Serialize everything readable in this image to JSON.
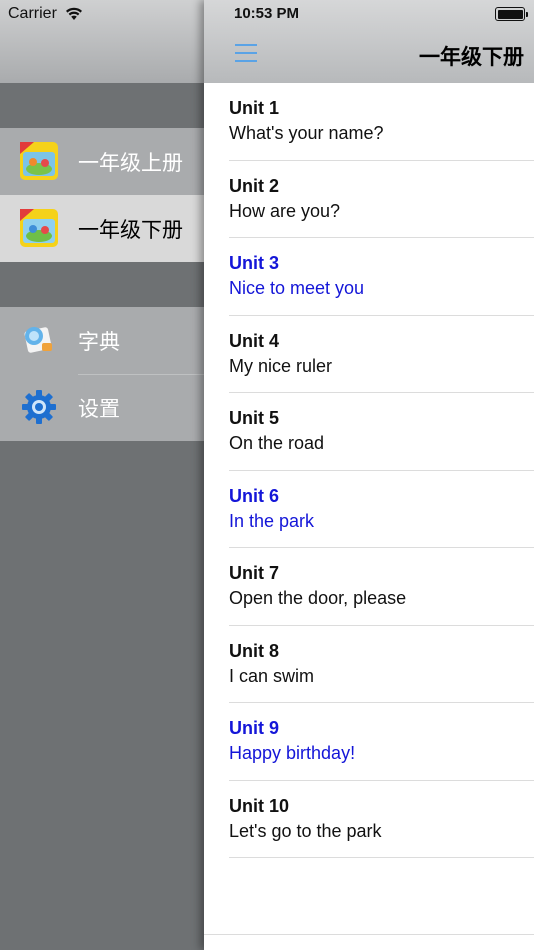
{
  "status": {
    "carrier": "Carrier",
    "time": "10:53 PM"
  },
  "drawer": {
    "books": [
      {
        "label": "一年级上册",
        "selected": false
      },
      {
        "label": "一年级下册",
        "selected": true
      }
    ],
    "tools": [
      {
        "label": "字典",
        "icon": "dictionary-icon"
      },
      {
        "label": "设置",
        "icon": "gear-icon"
      }
    ]
  },
  "header": {
    "title": "一年级下册",
    "menu_icon": "hamburger-menu-icon"
  },
  "units": [
    {
      "unit": "Unit 1",
      "title": "What's your name?",
      "highlight": false
    },
    {
      "unit": "Unit 2",
      "title": "How are you?",
      "highlight": false
    },
    {
      "unit": "Unit 3",
      "title": "Nice to meet you",
      "highlight": true
    },
    {
      "unit": "Unit 4",
      "title": "My nice ruler",
      "highlight": false
    },
    {
      "unit": "Unit 5",
      "title": "On the road",
      "highlight": false
    },
    {
      "unit": "Unit 6",
      "title": "In the park",
      "highlight": true
    },
    {
      "unit": "Unit 7",
      "title": "Open the door, please",
      "highlight": false
    },
    {
      "unit": "Unit 8",
      "title": "I can swim",
      "highlight": false
    },
    {
      "unit": "Unit 9",
      "title": "Happy birthday!",
      "highlight": true
    },
    {
      "unit": "Unit 10",
      "title": "Let's go to the park",
      "highlight": false
    }
  ],
  "colors": {
    "highlight": "#1416d8",
    "menu_icon": "#5aa3e6"
  }
}
